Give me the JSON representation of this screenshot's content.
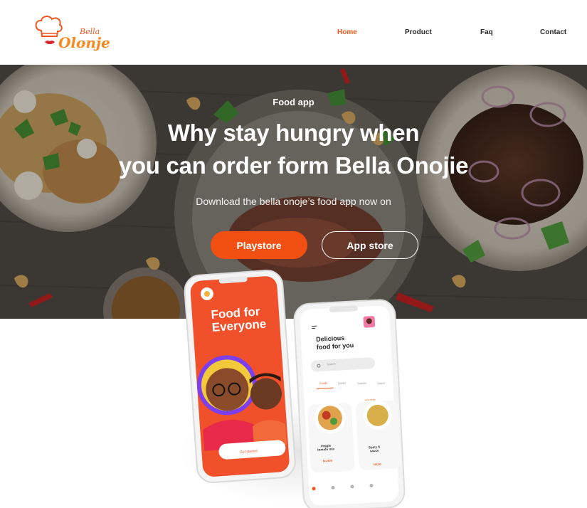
{
  "header": {
    "logo_alt": "Bella Olonje",
    "logo_text_small": "Bella",
    "logo_text_large": "Olonje",
    "nav": [
      {
        "label": "Home",
        "active": true
      },
      {
        "label": "Product",
        "active": false
      },
      {
        "label": "Faq",
        "active": false
      },
      {
        "label": "Contact",
        "active": false
      }
    ]
  },
  "hero": {
    "eyebrow": "Food app",
    "headline_line1": "Why stay hungry when",
    "headline_line2": "you can order form Bella Onojie",
    "subline": "Download the bella onoje’s food app now on",
    "buttons": {
      "playstore": "Playstore",
      "appstore": "App store"
    }
  },
  "phone_left": {
    "title_line1": "Food for",
    "title_line2": "Everyone",
    "cta": "Get started"
  },
  "phone_right": {
    "heading_line1": "Delicious",
    "heading_line2": "food for you",
    "search_placeholder": "Search",
    "tabs": [
      "Foods",
      "Drinks",
      "Snacks",
      "Sauce"
    ],
    "see_more": "see more",
    "items": [
      {
        "name_line1": "Veggie",
        "name_line2": "tomato mix",
        "price": "N1,900"
      },
      {
        "name_line1": "Spicy fi",
        "name_line2": "sauce",
        "price": "N2,30"
      }
    ]
  },
  "colors": {
    "accent": "#f24f12",
    "nav_active": "#f2561d",
    "phone_left_screen": "#f0502a",
    "text_dark": "#2b2b2b"
  }
}
